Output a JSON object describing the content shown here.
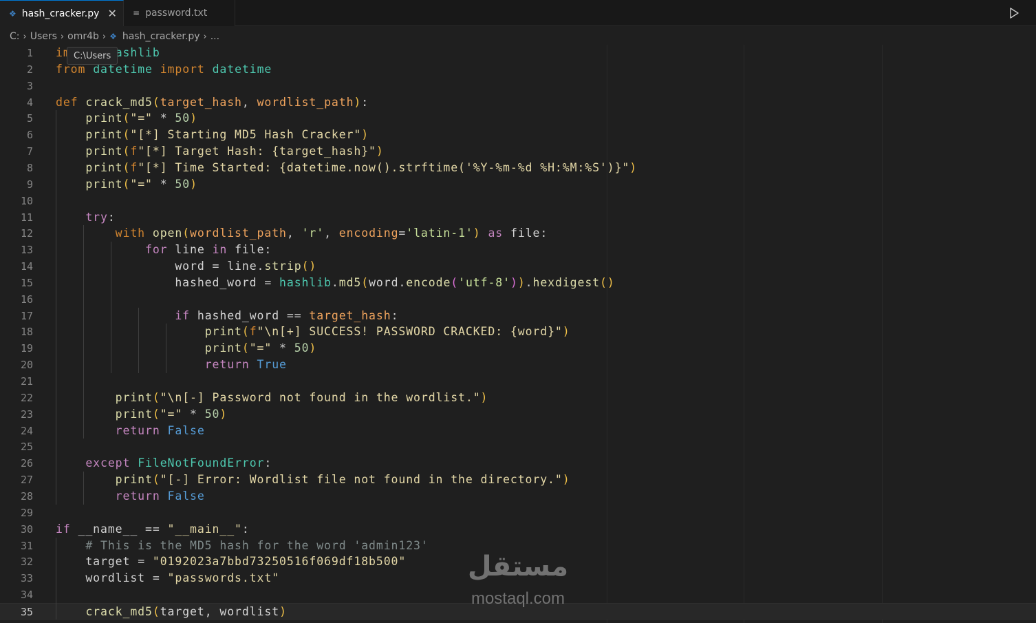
{
  "tabs": [
    {
      "label": "hash_cracker.py",
      "icon": "python-icon",
      "active": true
    },
    {
      "label": "password.txt",
      "icon": "text-file-icon",
      "active": false
    }
  ],
  "breadcrumb": {
    "drive": "C:",
    "users": "Users",
    "user": "omr4b",
    "file": "hash_cracker.py",
    "more": "..."
  },
  "tooltip": "C:\\Users",
  "cursor_line": 35,
  "line_numbers": [
    "1",
    "2",
    "3",
    "4",
    "5",
    "6",
    "7",
    "8",
    "9",
    "10",
    "11",
    "12",
    "13",
    "14",
    "15",
    "16",
    "17",
    "18",
    "19",
    "20",
    "21",
    "22",
    "23",
    "24",
    "25",
    "26",
    "27",
    "28",
    "29",
    "30",
    "31",
    "32",
    "33",
    "34",
    "35"
  ],
  "code_lines": [
    "import hashlib",
    "from datetime import datetime",
    "",
    "def crack_md5(target_hash, wordlist_path):",
    "    print(\"=\" * 50)",
    "    print(\"[*] Starting MD5 Hash Cracker\")",
    "    print(f\"[*] Target Hash: {target_hash}\")",
    "    print(f\"[*] Time Started: {datetime.now().strftime('%Y-%m-%d %H:%M:%S')}\")",
    "    print(\"=\" * 50)",
    "",
    "    try:",
    "        with open(wordlist_path, 'r', encoding='latin-1') as file:",
    "            for line in file:",
    "                word = line.strip()",
    "                hashed_word = hashlib.md5(word.encode('utf-8')).hexdigest()",
    "",
    "                if hashed_word == target_hash:",
    "                    print(f\"\\n[+] SUCCESS! PASSWORD CRACKED: {word}\")",
    "                    print(\"=\" * 50)",
    "                    return True",
    "",
    "        print(\"\\n[-] Password not found in the wordlist.\")",
    "        print(\"=\" * 50)",
    "        return False",
    "",
    "    except FileNotFoundError:",
    "        print(\"[-] Error: Wordlist file not found in the directory.\")",
    "        return False",
    "",
    "if __name__ == \"__main__\":",
    "    # This is the MD5 hash for the word 'admin123'",
    "    target = \"0192023a7bbd73250516f069df18b500\"",
    "    wordlist = \"passwords.txt\"",
    "",
    "    crack_md5(target, wordlist)"
  ],
  "watermark": {
    "arabic": "مستقل",
    "latin": "mostaql.com"
  },
  "colors": {
    "editor_bg": "#1f1f1f",
    "tab_active_border": "#0078d4",
    "keyword": "#d4862f",
    "function": "#dcdcaa",
    "module": "#4ec9b0"
  }
}
